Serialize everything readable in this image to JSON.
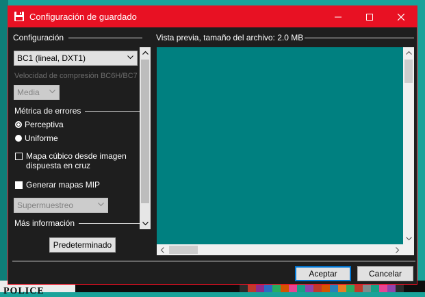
{
  "window": {
    "title": "Configuración de guardado",
    "accent_color": "#e81123",
    "icons": {
      "app": "floppy-disk-icon",
      "minimize": "minimize-icon",
      "maximize": "maximize-icon",
      "close": "close-icon"
    }
  },
  "config": {
    "section_title": "Configuración",
    "format_select": {
      "value": "BC1 (lineal, DXT1)"
    },
    "compression_speed_label": "Velocidad de compresión BC6H/BC7",
    "compression_speed_select": {
      "value": "Media",
      "disabled": true
    },
    "error_metric": {
      "section_title": "Métrica de errores",
      "options": [
        {
          "label": "Perceptiva",
          "selected": true
        },
        {
          "label": "Uniforme",
          "selected": false
        }
      ]
    },
    "cubemap_checkbox": {
      "label_line1": "Mapa cúbico desde imagen",
      "label_line2": "dispuesta en cruz",
      "checked": false
    },
    "mipmaps_checkbox": {
      "label": "Generar mapas MIP",
      "checked": false
    },
    "supersample_select": {
      "value": "Supermuestreo",
      "disabled": true
    },
    "more_info_title": "Más información"
  },
  "preview": {
    "section_title": "Vista previa, tamaño del archivo: 2.0 MB",
    "fill_color": "#008080"
  },
  "buttons": {
    "default_label": "Predeterminado",
    "accept_label": "Aceptar",
    "cancel_label": "Cancelar"
  },
  "background": {
    "text_fragment": "POLICE"
  }
}
